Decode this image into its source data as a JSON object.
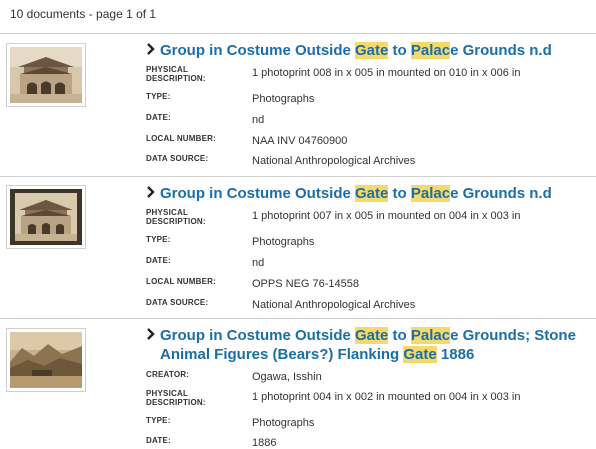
{
  "summary": "10 documents - page 1 of 1",
  "colors": {
    "link": "#1b6fa6",
    "highlight": "#f5d96b",
    "divider": "#cfcfcf"
  },
  "field_labels": {
    "physical": "PHYSICAL DESCRIPTION:",
    "type": "TYPE:",
    "date": "DATE:",
    "local": "LOCAL NUMBER:",
    "source": "DATA SOURCE:",
    "creator": "CREATOR:"
  },
  "results": [
    {
      "title": {
        "p1": "Group in Costume Outside ",
        "h1": "Gate",
        "p2": " to ",
        "h2": "Palac",
        "p3": "e Grounds n.d"
      },
      "physical": "1 photoprint 008 in x 005 in mounted on 010 in x 006 in",
      "type": "Photographs",
      "date": "nd",
      "local": "NAA INV 04760900",
      "source": "National Anthropological Archives"
    },
    {
      "title": {
        "p1": "Group in Costume Outside ",
        "h1": "Gate",
        "p2": " to ",
        "h2": "Palac",
        "p3": "e Grounds n.d"
      },
      "physical": "1 photoprint 007 in x 005 in mounted on 004 in x 003 in",
      "type": "Photographs",
      "date": "nd",
      "local": "OPPS NEG 76-14558",
      "source": "National Anthropological Archives"
    },
    {
      "title": {
        "p1": "Group in Costume Outside ",
        "h1": "Gate",
        "p2": " to ",
        "h2": "Palac",
        "p3": "e Grounds; Stone Animal Figures (Bears?) Flanking ",
        "h3": "Gate",
        "p4": " 1886"
      },
      "creator": "Ogawa, Isshin",
      "physical": "1 photoprint 004 in x 002 in mounted on 004 in x 003 in",
      "type": "Photographs",
      "date": "1886"
    }
  ]
}
